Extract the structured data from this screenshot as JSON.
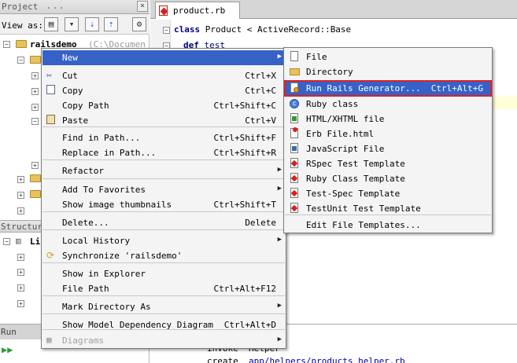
{
  "project_panel": {
    "title": "Project",
    "more": "...",
    "close": "×",
    "view_as_label": "View as:",
    "root_name": "railsdemo",
    "root_path": "(C:\\Documen",
    "structure_title": "Structure",
    "structure_item": "Li",
    "run_title": "Run"
  },
  "editor": {
    "tab_label": "product.rb",
    "code_line_1_kw": "class",
    "code_line_1_rest": " Product < ActiveRecord::Base",
    "code_line_2_kw": "def",
    "code_line_2_rest": " test",
    "run_line_1": "  Helper",
    "run_line_1_prefix": "invoke",
    "run_line_2_prefix": "create",
    "run_line_2_path": "app/helpers/products_helper.rb"
  },
  "context_menu": {
    "items": [
      {
        "label": "New",
        "shortcut": "",
        "submenu": true,
        "icon": "none",
        "selected": true
      },
      {
        "label": "Cut",
        "shortcut": "Ctrl+X",
        "icon": "scissors-icon"
      },
      {
        "label": "Copy",
        "shortcut": "Ctrl+C",
        "icon": "copy-icon"
      },
      {
        "label": "Copy Path",
        "shortcut": "Ctrl+Shift+C",
        "icon": "none"
      },
      {
        "label": "Paste",
        "shortcut": "Ctrl+V",
        "icon": "paste-icon"
      },
      {
        "label": "Find in Path...",
        "shortcut": "Ctrl+Shift+F",
        "icon": "none"
      },
      {
        "label": "Replace in Path...",
        "shortcut": "Ctrl+Shift+R",
        "icon": "none"
      },
      {
        "label": "Refactor",
        "shortcut": "",
        "submenu": true,
        "icon": "none"
      },
      {
        "label": "Add To Favorites",
        "shortcut": "",
        "submenu": true,
        "icon": "none"
      },
      {
        "label": "Show image thumbnails",
        "shortcut": "Ctrl+Shift+T",
        "icon": "none"
      },
      {
        "label": "Delete...",
        "shortcut": "Delete",
        "icon": "none"
      },
      {
        "label": "Local History",
        "shortcut": "",
        "submenu": true,
        "icon": "none"
      },
      {
        "label": "Synchronize 'railsdemo'",
        "shortcut": "",
        "icon": "sync-icon"
      },
      {
        "label": "Show in Explorer",
        "shortcut": "",
        "icon": "none"
      },
      {
        "label": "File Path",
        "shortcut": "Ctrl+Alt+F12",
        "icon": "none"
      },
      {
        "label": "Mark Directory As",
        "shortcut": "",
        "submenu": true,
        "icon": "none"
      },
      {
        "label": "Show Model Dependency Diagram",
        "shortcut": "Ctrl+Alt+D",
        "icon": "none"
      },
      {
        "label": "Diagrams",
        "shortcut": "",
        "submenu": true,
        "icon": "diagram-icon",
        "disabled": true
      }
    ]
  },
  "new_submenu": {
    "items": [
      {
        "label": "File",
        "shortcut": "",
        "icon": "file-icon"
      },
      {
        "label": "Directory",
        "shortcut": "",
        "icon": "folder-icon"
      },
      {
        "label": "Run Rails Generator...",
        "shortcut": "Ctrl+Alt+G",
        "icon": "rails-generator-icon",
        "selected": true
      },
      {
        "label": "Ruby class",
        "shortcut": "",
        "icon": "ruby-class-icon"
      },
      {
        "label": "HTML/XHTML file",
        "shortcut": "",
        "icon": "html-file-icon"
      },
      {
        "label": "Erb File.html",
        "shortcut": "",
        "icon": "erb-file-icon"
      },
      {
        "label": "JavaScript File",
        "shortcut": "",
        "icon": "javascript-file-icon"
      },
      {
        "label": "RSpec Test Template",
        "shortcut": "",
        "icon": "ruby-icon"
      },
      {
        "label": "Ruby Class Template",
        "shortcut": "",
        "icon": "ruby-icon"
      },
      {
        "label": "Test-Spec Template",
        "shortcut": "",
        "icon": "ruby-icon"
      },
      {
        "label": "TestUnit Test Template",
        "shortcut": "",
        "icon": "ruby-icon"
      },
      {
        "label": "Edit File Templates...",
        "shortcut": "",
        "icon": "none"
      }
    ]
  },
  "colors": {
    "selection": "#3662c8",
    "highlight_outline": "#e02020",
    "menu_background": "#f4f4f4"
  }
}
